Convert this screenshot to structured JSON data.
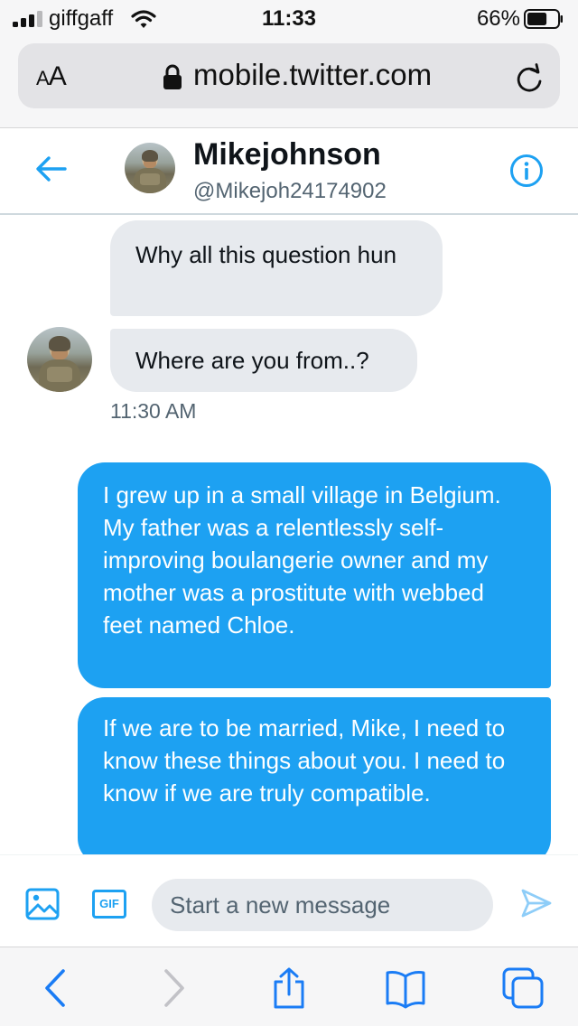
{
  "status_bar": {
    "carrier": "giffgaff",
    "time": "11:33",
    "battery_percent": "66%",
    "battery_level": 0.66
  },
  "browser": {
    "aa_large": "A",
    "aa_small": "A",
    "url": "mobile.twitter.com"
  },
  "dm_header": {
    "name": "Mikejohnson",
    "handle": "@Mikejoh24174902"
  },
  "conversation": {
    "received": [
      {
        "text": "Why all this question hun"
      },
      {
        "text": "Where are you from..?"
      }
    ],
    "received_timestamp": "11:30 AM",
    "sent": [
      {
        "text": "I grew up in a small village in Belgium. My father was a relentlessly self-improving boulangerie owner and my mother was a prostitute with webbed feet named Chloe."
      },
      {
        "text": "If we are to be married, Mike, I need to know these things about you. I need to know if we are truly compatible."
      }
    ]
  },
  "composer": {
    "gif_label": "GIF",
    "placeholder": "Start a new message",
    "value": ""
  },
  "icons": {
    "accent_color": "#1da1f2",
    "received_bubble_color": "#e7eaee",
    "sent_bubble_color": "#1da1f2"
  }
}
